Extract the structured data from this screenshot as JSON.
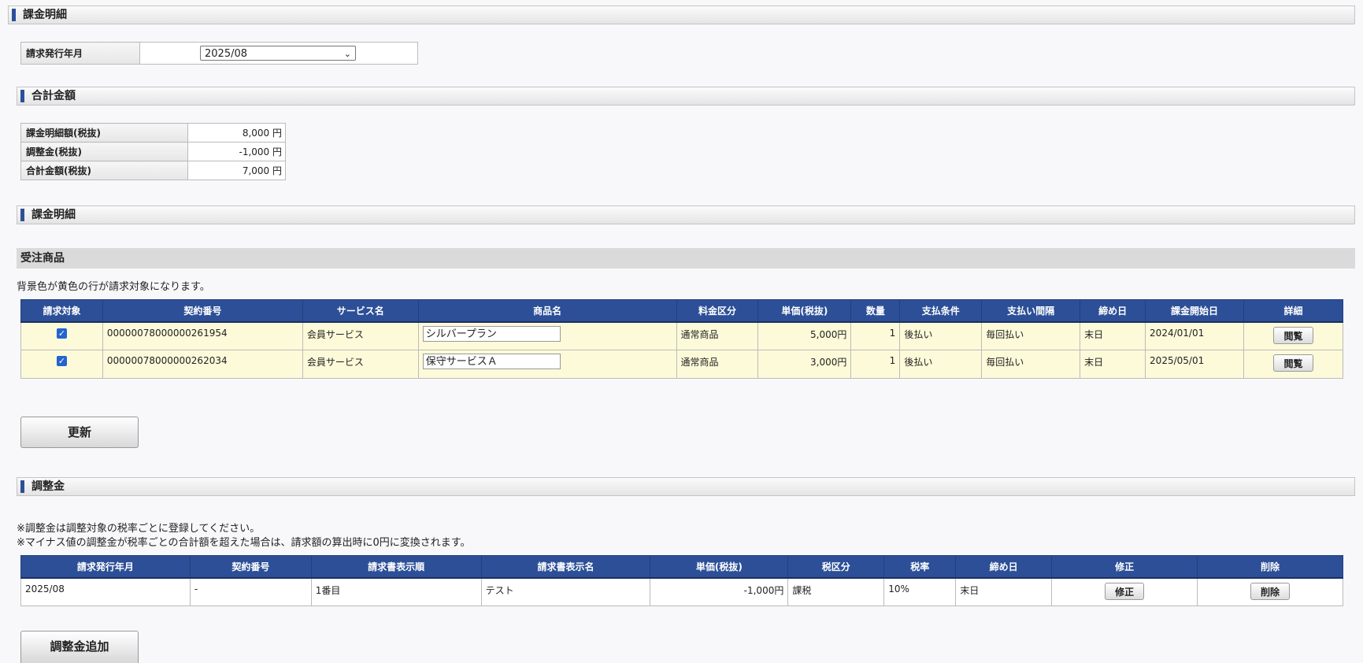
{
  "billing_detail_top": {
    "title": "課金明細"
  },
  "issue_month": {
    "label": "請求発行年月",
    "selected": "2025/08"
  },
  "totals": {
    "title": "合計金額",
    "rows": [
      {
        "label": "課金明細額(税抜)",
        "value": "8,000 円"
      },
      {
        "label": "調整金(税抜)",
        "value": "-1,000 円"
      },
      {
        "label": "合計金額(税抜)",
        "value": "7,000 円"
      }
    ]
  },
  "billing_detail": {
    "title": "課金明細"
  },
  "orders": {
    "title": "受注商品",
    "note": "背景色が黄色の行が請求対象になります。",
    "columns": [
      "請求対象",
      "契約番号",
      "サービス名",
      "商品名",
      "料金区分",
      "単価(税抜)",
      "数量",
      "支払条件",
      "支払い間隔",
      "締め日",
      "課金開始日",
      "詳細"
    ],
    "rows": [
      {
        "checked": "✓",
        "contract": "00000078000000261954",
        "service": "会員サービス",
        "product": "シルバープラン",
        "fee_type": "通常商品",
        "unit_price": "5,000円",
        "qty": "1",
        "pay_term": "後払い",
        "interval": "毎回払い",
        "closing": "末日",
        "start": "2024/01/01",
        "view": "閲覧"
      },
      {
        "checked": "✓",
        "contract": "00000078000000262034",
        "service": "会員サービス",
        "product": "保守サービスＡ",
        "fee_type": "通常商品",
        "unit_price": "3,000円",
        "qty": "1",
        "pay_term": "後払い",
        "interval": "毎回払い",
        "closing": "末日",
        "start": "2025/05/01",
        "view": "閲覧"
      }
    ],
    "update_button": "更新"
  },
  "adjustment": {
    "title": "調整金",
    "note1": "※調整金は調整対象の税率ごとに登録してください。",
    "note2": "※マイナス値の調整金が税率ごとの合計額を超えた場合は、請求額の算出時に0円に変換されます。",
    "columns": [
      "請求発行年月",
      "契約番号",
      "請求書表示順",
      "請求書表示名",
      "単価(税抜)",
      "税区分",
      "税率",
      "締め日",
      "修正",
      "削除"
    ],
    "rows": [
      {
        "month": "2025/08",
        "contract": "-",
        "order": "1番目",
        "name": "テスト",
        "unit_price": "-1,000円",
        "tax_type": "課税",
        "tax_rate": "10%",
        "closing": "末日",
        "edit": "修正",
        "delete": "削除"
      }
    ],
    "add_button": "調整金追加"
  }
}
